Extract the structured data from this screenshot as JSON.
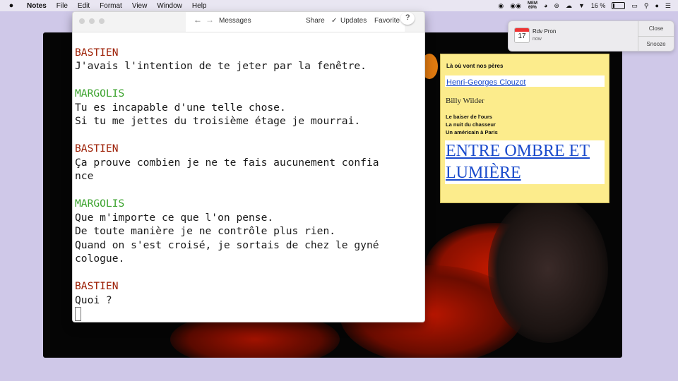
{
  "menubar": {
    "app_name": "Notes",
    "items": [
      "File",
      "Edit",
      "Format",
      "View",
      "Window",
      "Help"
    ],
    "memory_label": "MEM",
    "memory_value": "69%",
    "battery_text": "16 %"
  },
  "notification": {
    "title": "Rdv Pron",
    "subtitle": "now",
    "calendar_day": "17",
    "close_label": "Close",
    "snooze_label": "Snooze"
  },
  "yellow_page": {
    "title": "Là où vont nos pères",
    "link1": "Henri-Georges Clouzot",
    "name": "Billy Wilder",
    "list": [
      "Le baiser de l'ours",
      "La nuit du chasseur",
      "Un américain à Paris"
    ],
    "big_link_line1": "ENTRE OMBRE ET",
    "big_link_line2": "LUMIÈRE"
  },
  "messages_window": {
    "title": "Messages",
    "share_label": "Share",
    "updates_label": "Updates",
    "favorite_label": "Favorite",
    "help_label": "?"
  },
  "chat": [
    {
      "speaker": "BASTIEN",
      "color": "#9b1b00",
      "lines": [
        "J'avais l'intention de te jeter par la fenêtre."
      ]
    },
    {
      "speaker": "MARGOLIS",
      "color": "#3aa22c",
      "lines": [
        "Tu es incapable d'une telle chose.",
        "Si tu me jettes du troisième étage je mourrai."
      ]
    },
    {
      "speaker": "BASTIEN",
      "color": "#9b1b00",
      "lines": [
        "Ça prouve combien je ne te fais aucunement confia",
        "nce"
      ]
    },
    {
      "speaker": "MARGOLIS",
      "color": "#3aa22c",
      "lines": [
        "Que m'importe ce que l'on pense.",
        "De toute manière je ne contrôle plus rien.",
        "Quand on s'est croisé, je sortais de chez le gyné",
        "cologue."
      ]
    },
    {
      "speaker": "BASTIEN",
      "color": "#9b1b00",
      "lines": [
        "Quoi ?"
      ]
    }
  ]
}
